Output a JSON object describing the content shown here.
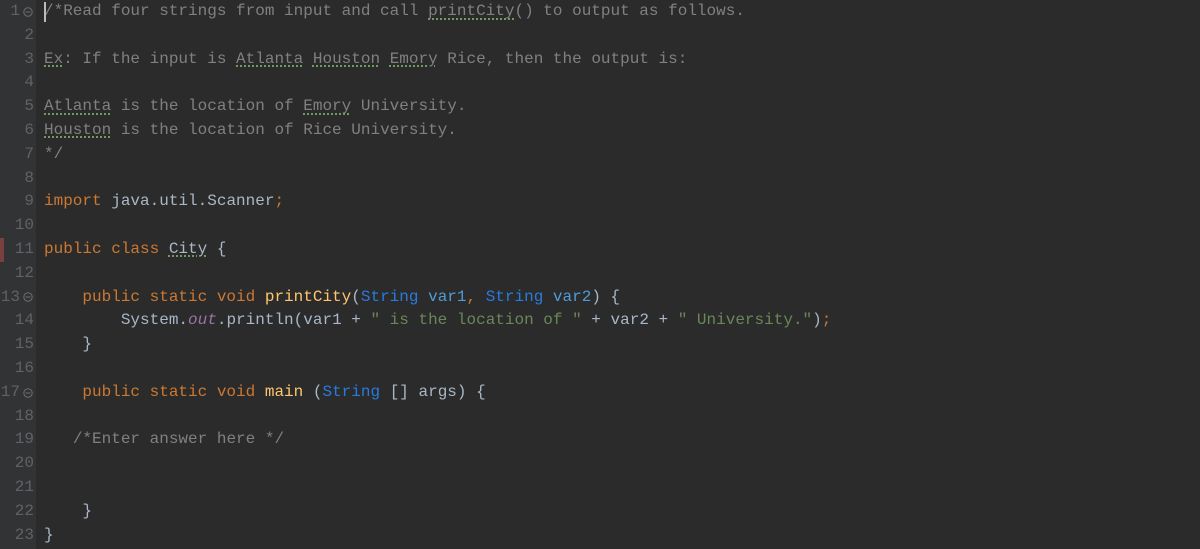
{
  "lines": [
    {
      "num": "1",
      "fold": "minus",
      "segments": [
        {
          "t": "/*",
          "c": "comment"
        },
        {
          "t": "Read four strings from input and call ",
          "c": "comment",
          "cursor": true
        },
        {
          "t": "printCity",
          "c": "comment-spell"
        },
        {
          "t": "() to output as follows.",
          "c": "comment"
        }
      ]
    },
    {
      "num": "2",
      "segments": []
    },
    {
      "num": "3",
      "segments": [
        {
          "t": "Ex",
          "c": "comment-spell"
        },
        {
          "t": ": If the input is ",
          "c": "comment"
        },
        {
          "t": "Atlanta",
          "c": "comment-spell"
        },
        {
          "t": " ",
          "c": "comment"
        },
        {
          "t": "Houston",
          "c": "comment-spell"
        },
        {
          "t": " ",
          "c": "comment"
        },
        {
          "t": "Emory",
          "c": "comment-spell"
        },
        {
          "t": " Rice, then the output is:",
          "c": "comment"
        }
      ]
    },
    {
      "num": "4",
      "segments": []
    },
    {
      "num": "5",
      "segments": [
        {
          "t": "Atlanta",
          "c": "comment-spell"
        },
        {
          "t": " is the location of ",
          "c": "comment"
        },
        {
          "t": "Emory",
          "c": "comment-spell"
        },
        {
          "t": " University.",
          "c": "comment"
        }
      ]
    },
    {
      "num": "6",
      "segments": [
        {
          "t": "Houston",
          "c": "comment-spell"
        },
        {
          "t": " is the location of Rice University.",
          "c": "comment"
        }
      ]
    },
    {
      "num": "7",
      "segments": [
        {
          "t": "*/",
          "c": "comment"
        }
      ]
    },
    {
      "num": "8",
      "segments": []
    },
    {
      "num": "9",
      "segments": [
        {
          "t": "import ",
          "c": "keyword"
        },
        {
          "t": "java.util.Scanner",
          "c": "default"
        },
        {
          "t": ";",
          "c": "punct"
        }
      ]
    },
    {
      "num": "10",
      "segments": []
    },
    {
      "num": "11",
      "marker": true,
      "segments": [
        {
          "t": "public class ",
          "c": "keyword"
        },
        {
          "t": "City",
          "c": "classname"
        },
        {
          "t": " {",
          "c": "default"
        }
      ]
    },
    {
      "num": "12",
      "segments": []
    },
    {
      "num": "13",
      "fold": "minus",
      "indent": "    ",
      "segments": [
        {
          "t": "public static void ",
          "c": "keyword"
        },
        {
          "t": "printCity",
          "c": "method-decl"
        },
        {
          "t": "(",
          "c": "default"
        },
        {
          "t": "String ",
          "c": "type-use"
        },
        {
          "t": "var1",
          "c": "param"
        },
        {
          "t": ", ",
          "c": "punct"
        },
        {
          "t": "String ",
          "c": "type-use"
        },
        {
          "t": "var2",
          "c": "param"
        },
        {
          "t": ") {",
          "c": "default"
        }
      ]
    },
    {
      "num": "14",
      "indent": "        ",
      "segments": [
        {
          "t": "System.",
          "c": "default"
        },
        {
          "t": "out",
          "c": "static-field"
        },
        {
          "t": ".println(var1 + ",
          "c": "default"
        },
        {
          "t": "\" is the location of \"",
          "c": "string"
        },
        {
          "t": " + var2 + ",
          "c": "default"
        },
        {
          "t": "\" University.\"",
          "c": "string"
        },
        {
          "t": ")",
          "c": "default"
        },
        {
          "t": ";",
          "c": "punct"
        }
      ]
    },
    {
      "num": "15",
      "indent": "    ",
      "segments": [
        {
          "t": "}",
          "c": "default"
        }
      ]
    },
    {
      "num": "16",
      "segments": []
    },
    {
      "num": "17",
      "fold": "minus",
      "indent": "    ",
      "segments": [
        {
          "t": "public static void ",
          "c": "keyword"
        },
        {
          "t": "main ",
          "c": "method-decl"
        },
        {
          "t": "(",
          "c": "default"
        },
        {
          "t": "String ",
          "c": "type-use"
        },
        {
          "t": "[] args) {",
          "c": "default"
        }
      ]
    },
    {
      "num": "18",
      "segments": []
    },
    {
      "num": "19",
      "indent": "   ",
      "segments": [
        {
          "t": "/*Enter answer here */",
          "c": "comment"
        }
      ]
    },
    {
      "num": "20",
      "segments": []
    },
    {
      "num": "21",
      "segments": []
    },
    {
      "num": "22",
      "indent": "    ",
      "segments": [
        {
          "t": "}",
          "c": "default"
        }
      ]
    },
    {
      "num": "23",
      "segments": [
        {
          "t": "}",
          "c": "default"
        }
      ]
    }
  ]
}
